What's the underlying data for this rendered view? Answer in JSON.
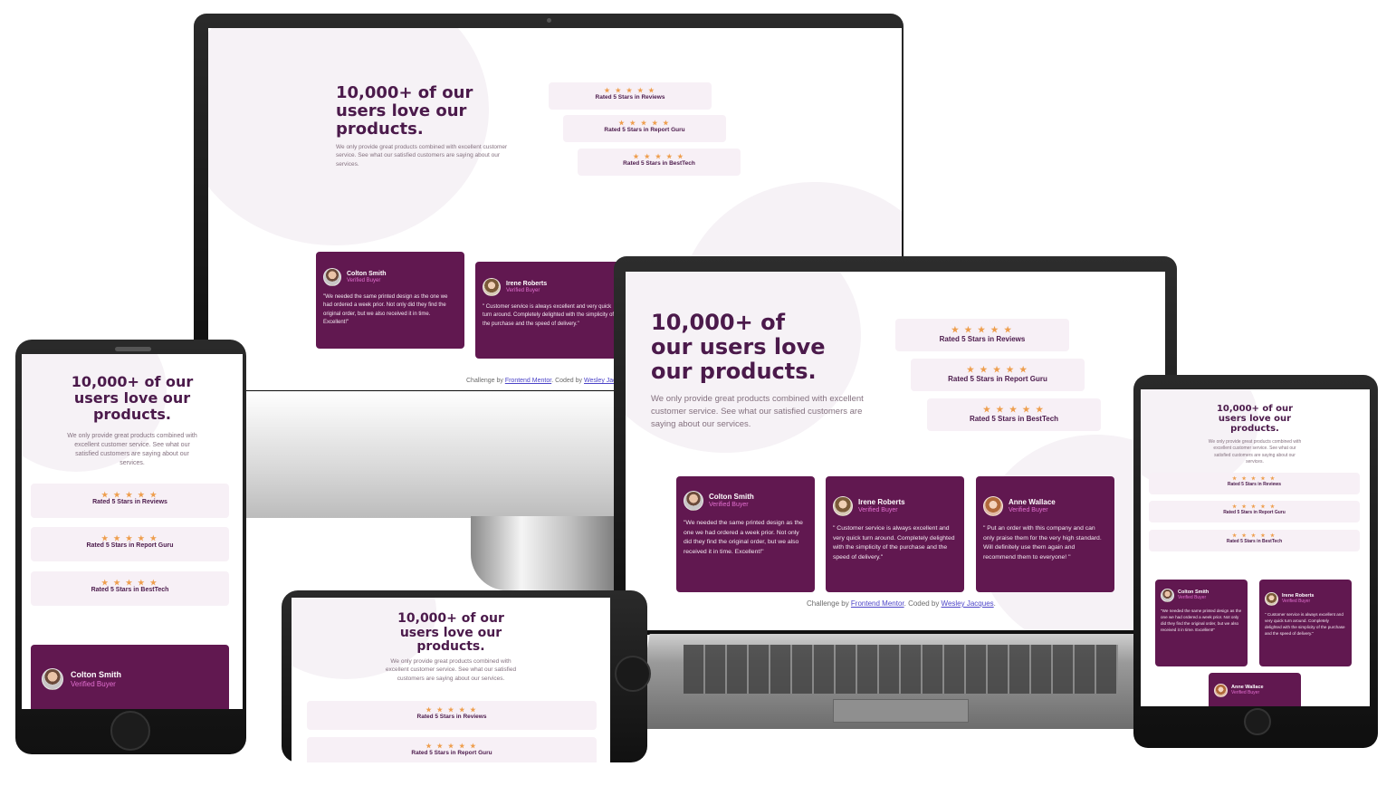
{
  "headline": "10,000+ of our users love our products.",
  "intro": "We only provide great products combined with excellent customer service. See what our satisfied customers are saying about our services.",
  "star_glyphs": "★ ★ ★ ★ ★",
  "ratings": [
    "Rated 5 Stars in Reviews",
    "Rated 5 Stars in Report Guru",
    "Rated 5 Stars in BestTech"
  ],
  "testimonials": [
    {
      "name": "Colton Smith",
      "badge": "Verified Buyer",
      "quote": "\"We needed the same printed design as the one we had ordered a week prior. Not only did they find the original order, but we also received it in time. Excellent!\"",
      "avatar": "man-beard-avatar"
    },
    {
      "name": "Irene Roberts",
      "badge": "Verified Buyer",
      "quote": "\" Customer service is always excellent and very quick turn around. Completely delighted with the simplicity of the purchase and the speed of delivery.\"",
      "avatar": "woman-avatar"
    },
    {
      "name": "Anne Wallace",
      "badge": "Verified Buyer",
      "quote": "\" Put an order with this company and can only praise them for the very high standard. Will definitely use them again and recommend them to everyone! \"",
      "avatar": "woman-red-hair-avatar"
    }
  ],
  "footer": {
    "prefix": "Challenge by ",
    "link1": "Frontend Mentor",
    "middle": ". Coded by ",
    "link2": "Wesley Jacques",
    "suffix": "."
  },
  "colors": {
    "dark_magenta": "#611850",
    "headline": "#4b1a4b",
    "rating_bg": "#f7f0f6",
    "stars": "#ee9e4d",
    "verified": "#e26fd0"
  }
}
